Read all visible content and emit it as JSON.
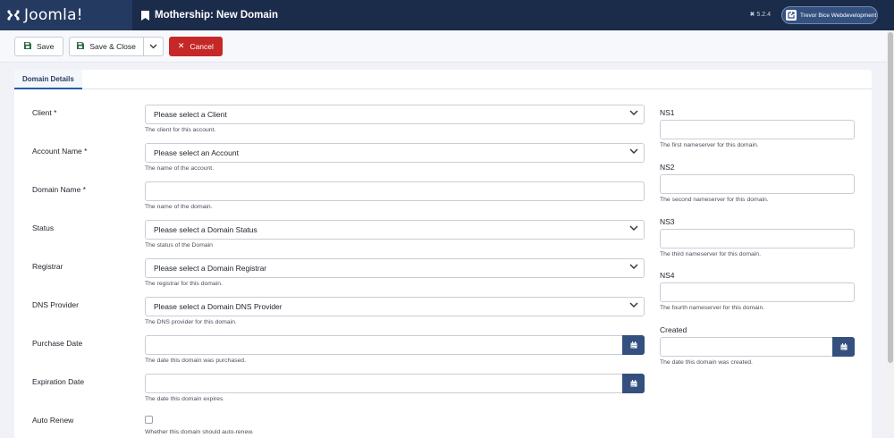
{
  "header": {
    "brand": "Joomla!",
    "title": "Mothership: New Domain",
    "version": "5.2.4",
    "site_button": "Trevor Bice Webdevelopment"
  },
  "toolbar": {
    "save": "Save",
    "save_close": "Save & Close",
    "cancel": "Cancel"
  },
  "tabs": [
    "Domain Details"
  ],
  "form": {
    "client": {
      "label": "Client *",
      "value": "Please select a Client",
      "desc": "The client for this account."
    },
    "account": {
      "label": "Account Name *",
      "value": "Please select an Account",
      "desc": "The name of the account."
    },
    "domain": {
      "label": "Domain Name *",
      "value": "",
      "desc": "The name of the domain."
    },
    "status": {
      "label": "Status",
      "value": "Please select a Domain Status",
      "desc": "The status of the Domain"
    },
    "registrar": {
      "label": "Registrar",
      "value": "Please select a Domain Registrar",
      "desc": "The registrar for this domain."
    },
    "dns": {
      "label": "DNS Provider",
      "value": "Please select a Domain DNS Provider",
      "desc": "The DNS provider for this domain."
    },
    "purchase": {
      "label": "Purchase Date",
      "value": "",
      "desc": "The date this domain was purchased."
    },
    "expiration": {
      "label": "Expiration Date",
      "value": "",
      "desc": "The date this domain expires."
    },
    "autorenew": {
      "label": "Auto Renew",
      "checked": false,
      "desc": "Whether this domain should auto-renew."
    },
    "ns1": {
      "label": "NS1",
      "desc": "The first nameserver for this domain."
    },
    "ns2": {
      "label": "NS2",
      "desc": "The second nameserver for this domain."
    },
    "ns3": {
      "label": "NS3",
      "desc": "The third nameserver for this domain."
    },
    "ns4": {
      "label": "NS4",
      "desc": "The fourth nameserver for this domain."
    },
    "created": {
      "label": "Created",
      "desc": "The date this domain was created."
    }
  },
  "colors": {
    "header": "#1b2c4b",
    "accent": "#34507e",
    "cancel": "#c52827"
  }
}
